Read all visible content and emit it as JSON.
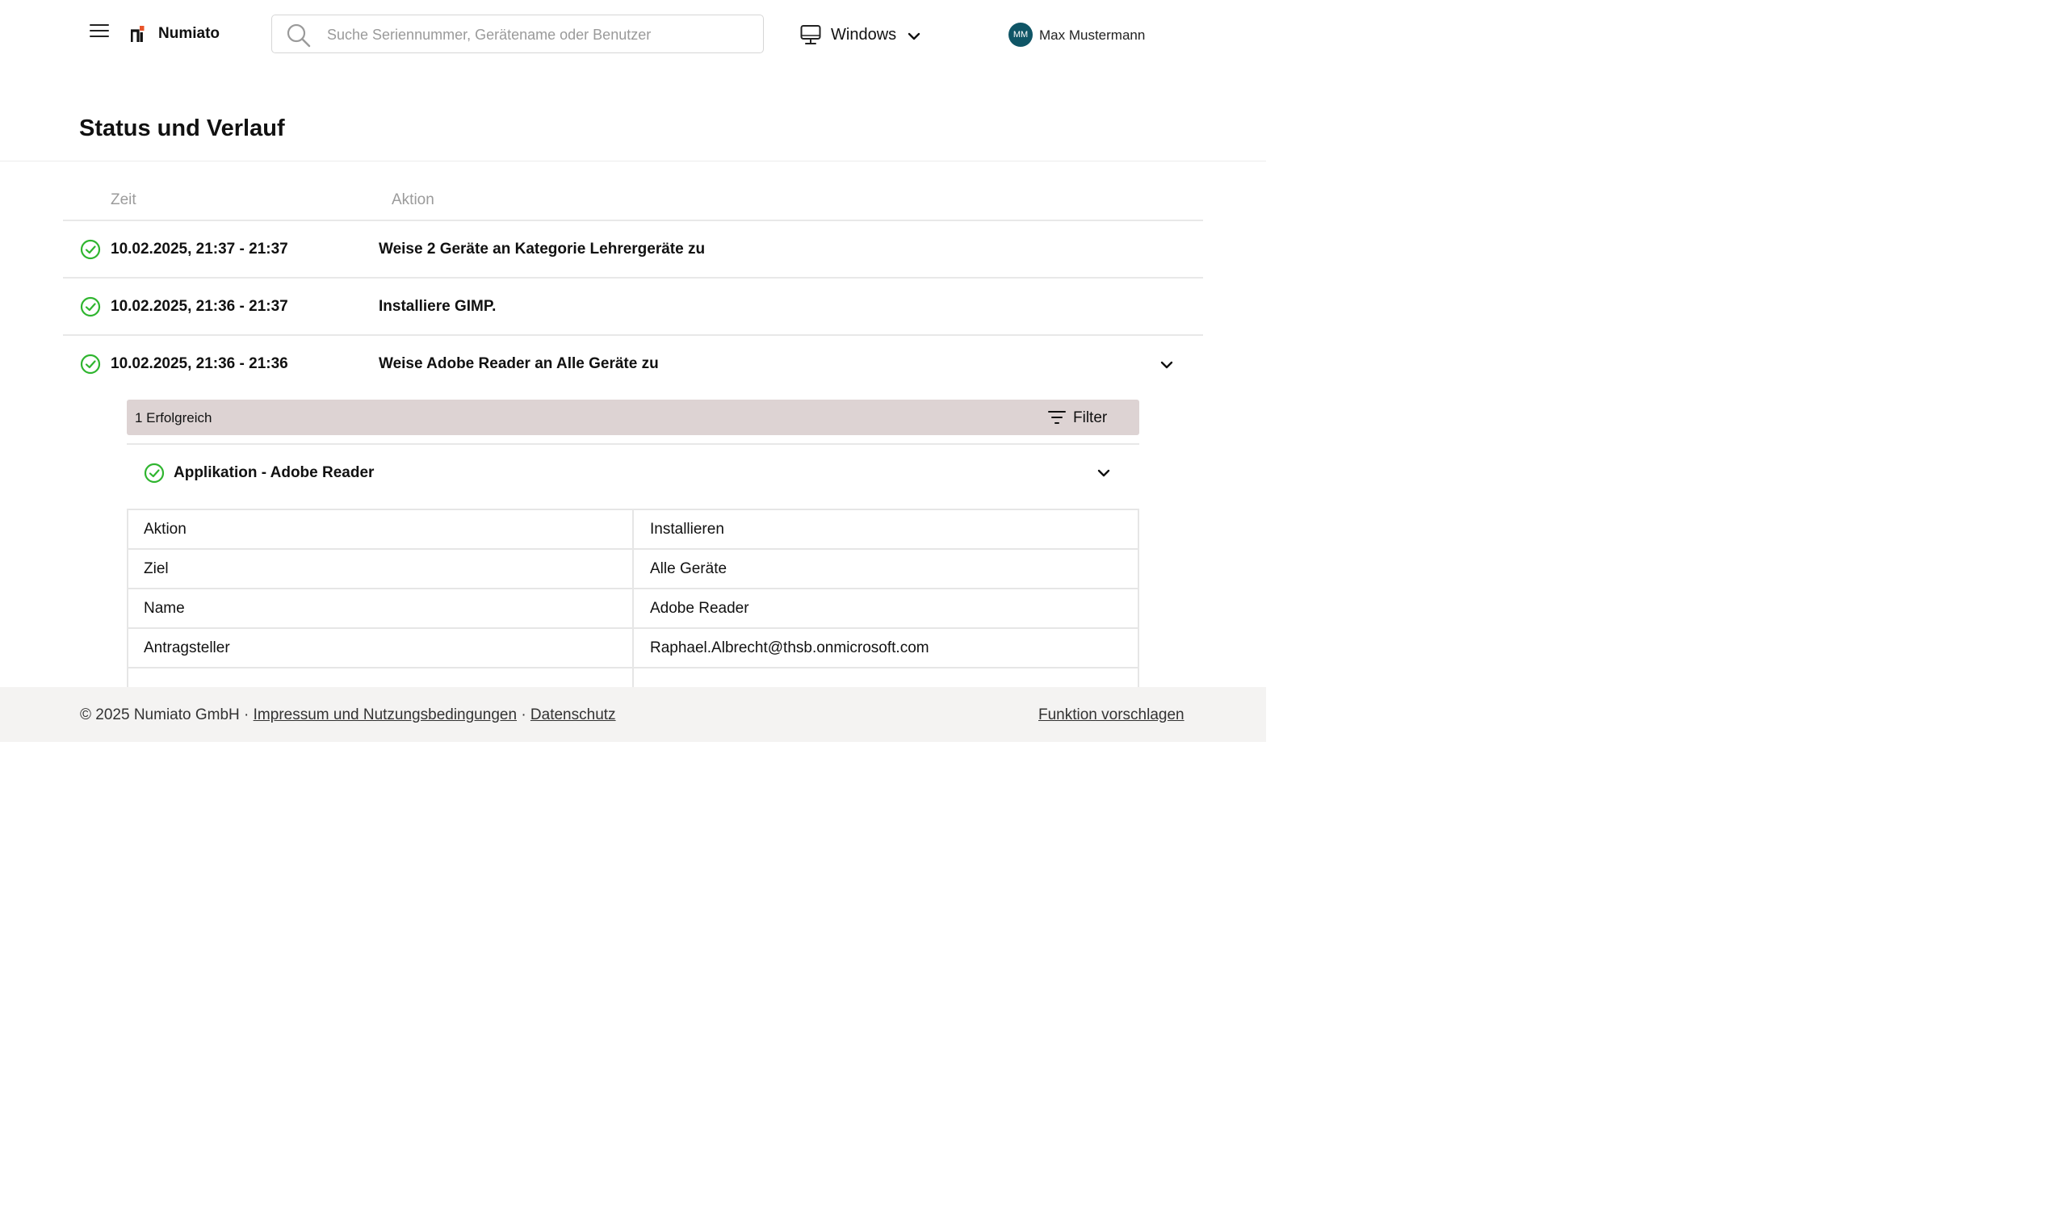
{
  "header": {
    "brand": "Numiato",
    "search": {
      "placeholder": "Suche Seriennummer, Gerätename oder Benutzer",
      "value": ""
    },
    "platform": {
      "label": "Windows",
      "icon": "monitor-icon"
    },
    "user": {
      "initials": "MM",
      "name": "Max Mustermann",
      "avatar_color": "#0f5566"
    }
  },
  "page": {
    "title": "Status und Verlauf"
  },
  "history": {
    "columns": {
      "time": "Zeit",
      "action": "Aktion"
    },
    "rows": [
      {
        "status": "success",
        "time": "10.02.2025, 21:37 - 21:37",
        "action": "Weise 2 Geräte an Kategorie Lehrergeräte zu"
      },
      {
        "status": "success",
        "time": "10.02.2025, 21:36 - 21:37",
        "action": "Installiere GIMP."
      },
      {
        "status": "success",
        "time": "10.02.2025, 21:36 - 21:36",
        "action": "Weise Adobe Reader an Alle Geräte zu",
        "expanded": true
      }
    ]
  },
  "detail": {
    "summary": "1 Erfolgreich",
    "filter_label": "Filter",
    "item": {
      "status": "success",
      "title": "Applikation - Adobe Reader",
      "properties": [
        {
          "key": "Aktion",
          "value": "Installieren"
        },
        {
          "key": "Ziel",
          "value": "Alle Geräte"
        },
        {
          "key": "Name",
          "value": "Adobe Reader"
        },
        {
          "key": "Antragsteller",
          "value": "Raphael.Albrecht@thsb.onmicrosoft.com"
        },
        {
          "key": "",
          "value": ""
        }
      ]
    }
  },
  "footer": {
    "copyright": "© 2025 Numiato GmbH",
    "separator": "·",
    "imprint_link": "Impressum und Nutzungsbedingungen",
    "privacy_link": "Datenschutz",
    "suggest_link": "Funktion vorschlagen"
  },
  "colors": {
    "success": "#2fb52f",
    "accent_logo": "#e8542a",
    "summary_bar": "#ddd3d3",
    "footer_bg": "#f4f3f2"
  }
}
